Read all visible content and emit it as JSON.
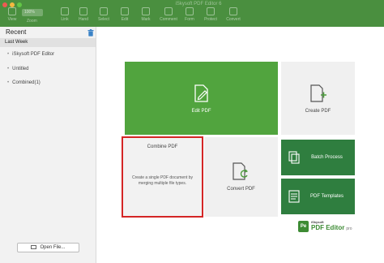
{
  "window": {
    "title": "iSkysoft PDF Editor 6",
    "zoom_value": "100%",
    "zoom_label": "Zoom"
  },
  "toolbar": {
    "items": [
      {
        "label": "View"
      },
      {
        "label": "Link"
      },
      {
        "label": "Hand"
      },
      {
        "label": "Select"
      },
      {
        "label": "Edit"
      },
      {
        "label": "Mark"
      },
      {
        "label": "Comment"
      },
      {
        "label": "Form"
      },
      {
        "label": "Protect"
      },
      {
        "label": "Convert"
      }
    ]
  },
  "sidebar": {
    "title": "Recent",
    "group": "Last Week",
    "files": [
      {
        "name": "iSkysoft PDF Editor"
      },
      {
        "name": "Untitled"
      },
      {
        "name": "Combined(1)"
      }
    ],
    "open_button": "Open File..."
  },
  "tiles": {
    "edit": "Edit PDF",
    "create": "Create PDF",
    "combine": "Combine PDF",
    "combine_desc": "Create a single PDF document by merging multiple file types.",
    "convert": "Convert PDF",
    "batch": "Batch Process",
    "templates": "PDF Templates"
  },
  "brand": {
    "maker": "iSkysoft",
    "product": "PDF Editor",
    "edition": "pro",
    "logo_text": "Pe"
  },
  "colors": {
    "toolbar": "#4a8f3f",
    "edit_tile": "#51a43e",
    "dark_tile": "#2f7e3f",
    "highlight": "#d42626"
  }
}
